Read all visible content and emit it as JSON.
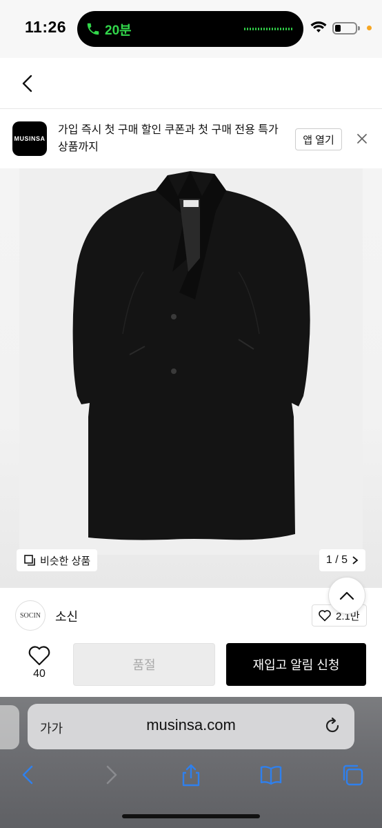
{
  "status_bar": {
    "time": "11:26",
    "call_duration": "20분"
  },
  "nav": {
    "back_icon": "chevron-left-icon",
    "home_icon": "home-icon",
    "search_icon": "search-icon",
    "cart_icon": "shopping-bag-icon"
  },
  "app_banner": {
    "logo_text": "MUSINSA",
    "message": "가입 즉시 첫 구매 할인 쿠폰과 첫 구매 전용 특가 상품까지",
    "open_button": "앱 열기"
  },
  "product_image": {
    "similar_label": "비슷한 상품",
    "pager": "1 / 5"
  },
  "brand": {
    "logo_text": "SOCIN",
    "name": "소신",
    "likes": "2.1만"
  },
  "actions": {
    "like_count": "40",
    "soldout_label": "품절",
    "restock_label": "재입고 알림 신청"
  },
  "safari": {
    "text_size_label": "가가",
    "url": "musinsa.com"
  },
  "colors": {
    "accent": "#000000",
    "call_green": "#32d74b",
    "safari_blue": "#2f80ed"
  }
}
